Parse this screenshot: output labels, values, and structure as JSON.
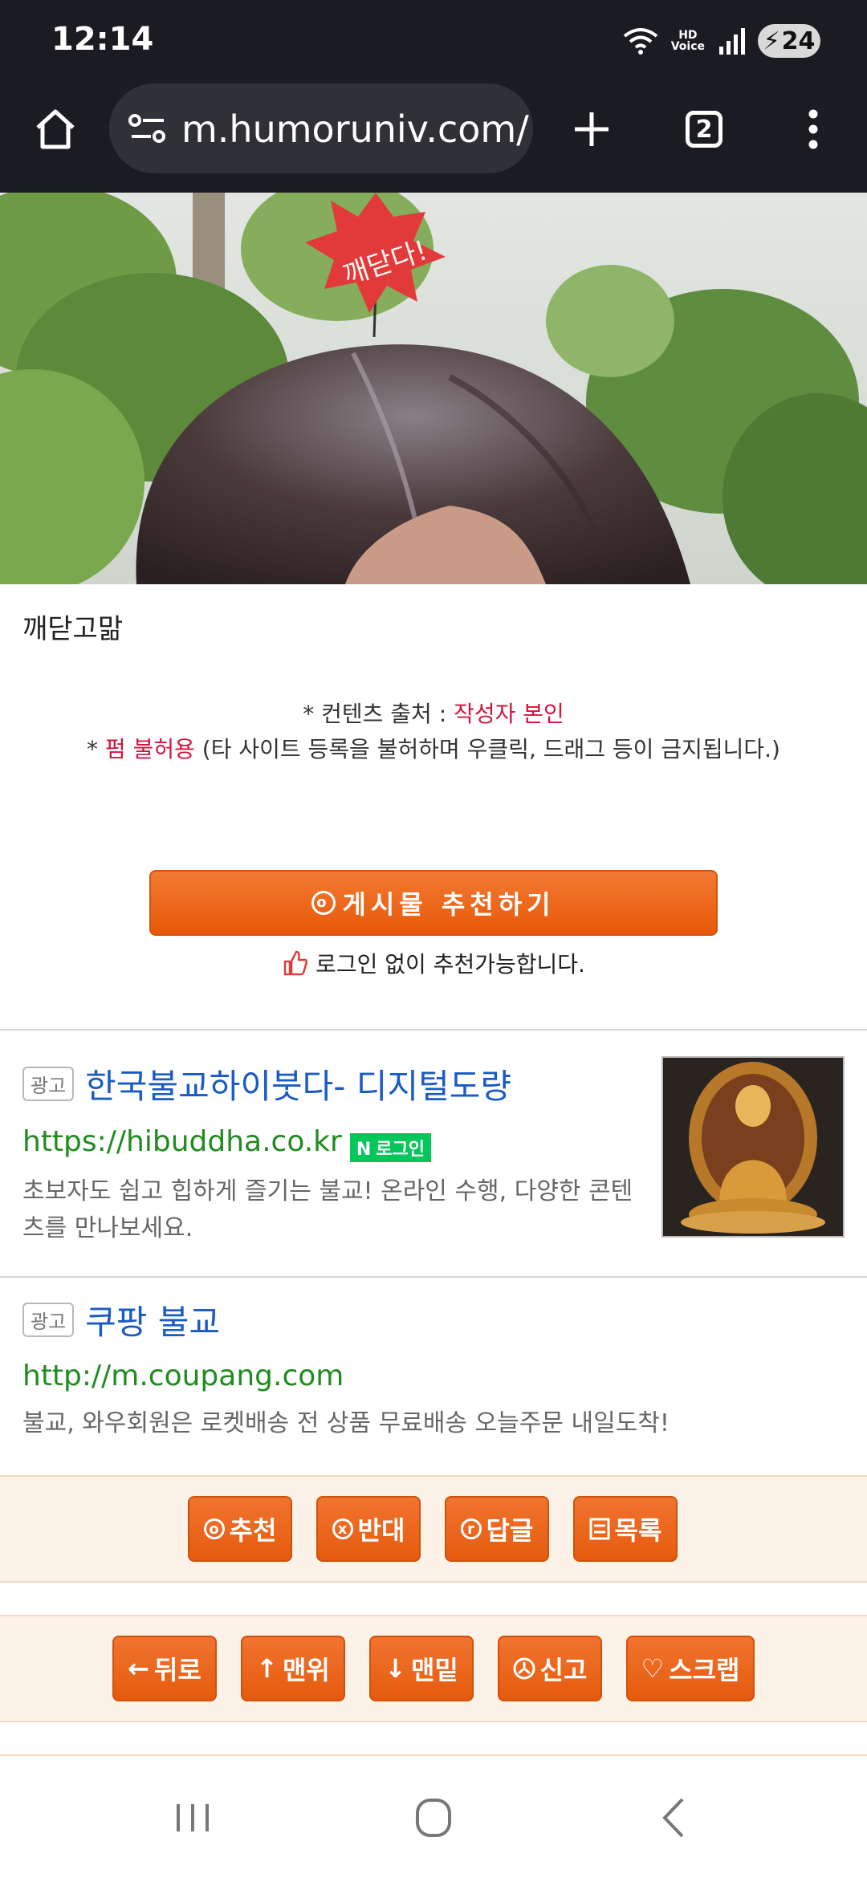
{
  "status_bar": {
    "time": "12:14",
    "hd_top": "HD",
    "hd_bottom": "Voice",
    "battery": "24"
  },
  "browser": {
    "url": "m.humoruniv.com/",
    "tab_count": "2"
  },
  "photo": {
    "sign_text": "깨닫다!"
  },
  "post": {
    "caption": "깨닫고맒",
    "source_prefix": "* 컨텐츠 출처 : ",
    "source_value": "작성자 본인",
    "perm_prefix": "* ",
    "perm_red": "펌 불허용",
    "perm_suffix": " (타 사이트 등록을 불허하며 우클릭, 드래그 등이 금지됩니다.)",
    "recommend_label": "게시물 추천하기",
    "login_note": "로그인 없이 추천가능합니다."
  },
  "ads": [
    {
      "badge": "광고",
      "title": "한국불교하이붓다- 디지털도량",
      "url": "https://hibuddha.co.kr",
      "login_badge": "로그인",
      "desc": "초보자도 쉽고 힙하게 즐기는 불교! 온라인 수행, 다양한 콘텐츠를 만나보세요."
    },
    {
      "badge": "광고",
      "title": "쿠팡 불교",
      "url": "http://m.coupang.com",
      "desc": "불교, 와우회원은 로켓배송 전 상품 무료배송 오늘주문 내일도착!"
    }
  ],
  "actions1": [
    {
      "label": "추천",
      "icon": "o"
    },
    {
      "label": "반대",
      "icon": "x"
    },
    {
      "label": "답글",
      "icon": "r"
    },
    {
      "label": "목록",
      "icon": "list"
    }
  ],
  "actions2": [
    {
      "label": "뒤로",
      "icon": "←"
    },
    {
      "label": "맨위",
      "icon": "↑"
    },
    {
      "label": "맨밑",
      "icon": "↓"
    },
    {
      "label": "신고",
      "icon": "report"
    },
    {
      "label": "스크랩",
      "icon": "♡"
    }
  ],
  "colors": {
    "accent": "#e85808",
    "link": "#1a5bc4",
    "url": "#1f8c1f",
    "warn": "#d2153d"
  }
}
